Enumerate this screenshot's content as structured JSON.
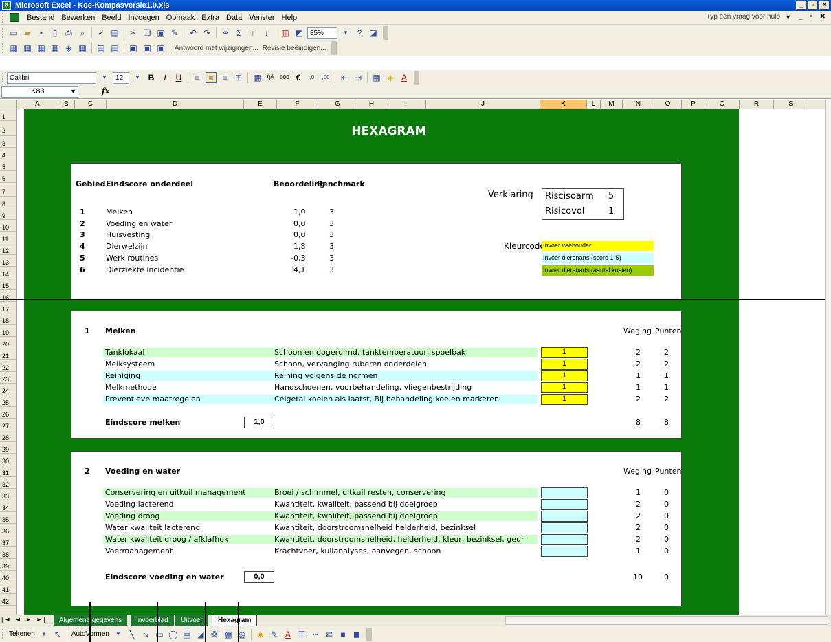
{
  "window": {
    "title": "Microsoft Excel - Koe-Kompasversie1.0.xls"
  },
  "menu": {
    "items": [
      "Bestand",
      "Bewerken",
      "Beeld",
      "Invoegen",
      "Opmaak",
      "Extra",
      "Data",
      "Venster",
      "Help"
    ],
    "help_placeholder": "Typ een vraag voor hulp"
  },
  "toolbar": {
    "zoom": "85%",
    "reply_changes": "Antwoord met wijzigingen...",
    "end_review": "Revisie beëindigen...",
    "font": "Calibri",
    "font_size": "12"
  },
  "formula": {
    "cell_ref": "K83",
    "fx": "fx"
  },
  "columns": [
    "A",
    "B",
    "C",
    "D",
    "E",
    "F",
    "G",
    "H",
    "I",
    "J",
    "K",
    "L",
    "M",
    "N",
    "O",
    "P",
    "Q",
    "R",
    "S"
  ],
  "selected_column": "K",
  "sheet": {
    "title": "HEXAGRAM",
    "summary": {
      "headers": {
        "gebied": "Gebied",
        "eindscore": "Eindscore onderdeel",
        "beoordeling": "Beoordeling",
        "benchmark": "Benchmark"
      },
      "rows": [
        {
          "nr": "1",
          "name": "Melken",
          "score": "1,0",
          "bench": "3"
        },
        {
          "nr": "2",
          "name": "Voeding en water",
          "score": "0,0",
          "bench": "3"
        },
        {
          "nr": "3",
          "name": "Huisvesting",
          "score": "0,0",
          "bench": "3"
        },
        {
          "nr": "4",
          "name": "Dierwelzijn",
          "score": "1,8",
          "bench": "3"
        },
        {
          "nr": "5",
          "name": "Werk routines",
          "score": "-0,3",
          "bench": "3"
        },
        {
          "nr": "6",
          "name": "Dierziekte incidentie",
          "score": "4,1",
          "bench": "3"
        }
      ],
      "verklaring_label": "Verklaring",
      "verklaring": [
        {
          "label": "Riscisoarm",
          "value": "5"
        },
        {
          "label": "Risicovol",
          "value": "1"
        }
      ],
      "kleurcode_label": "Kleurcode",
      "kleurcode": [
        {
          "label": "Invoer veehouder",
          "color": "#ffff00"
        },
        {
          "label": "Invoer dierenarts (score 1-5)",
          "color": "#ccffff"
        },
        {
          "label": "Invoer dierenarts (aantal koeien)",
          "color": "#99cc00"
        }
      ]
    },
    "sections": [
      {
        "nr": "1",
        "title": "Melken",
        "weging_label": "Weging",
        "punten_label": "Punten",
        "rows": [
          {
            "item": "Tanklokaal",
            "desc": "Schoon en opgeruimd, tanktemperatuur, spoelbak",
            "score": "1",
            "weging": "2",
            "punten": "2",
            "band": "green"
          },
          {
            "item": "Melksysteem",
            "desc": "Schoon, vervanging ruberen onderdelen",
            "score": "1",
            "weging": "2",
            "punten": "2",
            "band": "none"
          },
          {
            "item": "Reiniging",
            "desc": "Reining volgens de normen",
            "score": "1",
            "weging": "1",
            "punten": "1",
            "band": "cyan"
          },
          {
            "item": "Melkmethode",
            "desc": "Handschoenen, voorbehandeling, vliegenbestrijding",
            "score": "1",
            "weging": "1",
            "punten": "1",
            "band": "none"
          },
          {
            "item": "Preventieve maatregelen",
            "desc": "Celgetal koeien als laatst, Bij behandeling koeien markeren",
            "score": "1",
            "weging": "2",
            "punten": "2",
            "band": "cyan"
          }
        ],
        "total_label": "Eindscore melken",
        "total_score": "1,0",
        "total_weging": "8",
        "total_punten": "8"
      },
      {
        "nr": "2",
        "title": "Voeding en water",
        "weging_label": "Weging",
        "punten_label": "Punten",
        "rows": [
          {
            "item": "Conservering en uitkuil management",
            "desc": "Broei / schimmel, uitkuil resten, conservering",
            "score": "",
            "weging": "1",
            "punten": "0",
            "band": "green"
          },
          {
            "item": "Voeding lacterend",
            "desc": "Kwantiteit, kwaliteit, passend bij doelgroep",
            "score": "",
            "weging": "2",
            "punten": "0",
            "band": "none"
          },
          {
            "item": "Voeding droog",
            "desc": "Kwantiteit, kwaliteit, passend bij doelgroep",
            "score": "",
            "weging": "2",
            "punten": "0",
            "band": "green"
          },
          {
            "item": "Water kwaliteit lacterend",
            "desc": "Kwantiteit, doorstroomsnelheid helderheid, bezinksel",
            "score": "",
            "weging": "2",
            "punten": "0",
            "band": "none"
          },
          {
            "item": "Water kwaliteit droog  / afklafhok",
            "desc": "Kwantiteit, doorstroomsnelheid, helderheid, kleur, bezinksel, geur",
            "score": "",
            "weging": "2",
            "punten": "0",
            "band": "green"
          },
          {
            "item": "Voermanagement",
            "desc": "Krachtvoer, kuilanalyses, aanvegen, schoon",
            "score": "",
            "weging": "1",
            "punten": "0",
            "band": "none"
          }
        ],
        "total_label": "Eindscore voeding en water",
        "total_score": "0,0",
        "total_weging": "10",
        "total_punten": "0"
      }
    ]
  },
  "tabs": [
    {
      "label": "Algemene gegevens",
      "active": false
    },
    {
      "label": "Invoerblad",
      "active": false
    },
    {
      "label": "Uitvoer",
      "active": false
    },
    {
      "label": "Hexagram",
      "active": true
    }
  ],
  "drawbar": {
    "draw": "Tekenen",
    "autoshapes": "AutoVormen"
  }
}
